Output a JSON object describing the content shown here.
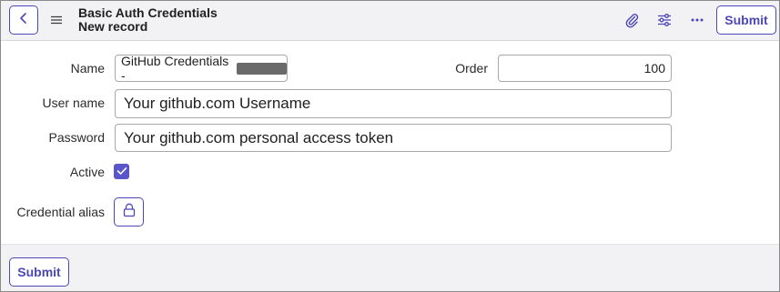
{
  "header": {
    "title": "Basic Auth Credentials",
    "subtitle": "New record",
    "submit_label": "Submit",
    "icons": [
      "chevron-left-icon",
      "hamburger-menu-icon",
      "paperclip-icon",
      "sliders-icon",
      "more-dots-icon"
    ]
  },
  "form": {
    "name_label": "Name",
    "name_value": "GitHub Credentials -",
    "order_label": "Order",
    "order_value": "100",
    "username_label": "User name",
    "username_value": "Your github.com Username",
    "password_label": "Password",
    "password_value": "Your github.com personal access token",
    "active_label": "Active",
    "active_checked": true,
    "alias_label": "Credential alias"
  },
  "footer": {
    "submit_label": "Submit"
  },
  "colors": {
    "accent": "#4b47b8",
    "checkbox": "#5a55c9",
    "header_bg": "#f2f2f4"
  }
}
